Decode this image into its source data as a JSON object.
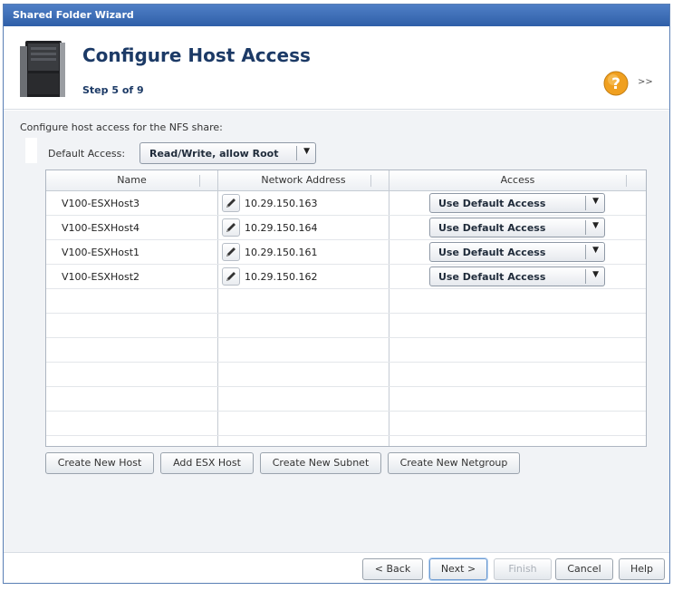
{
  "window": {
    "title": "Shared Folder Wizard"
  },
  "header": {
    "title": "Configure Host Access",
    "step": "Step 5 of 9",
    "expand": ">>"
  },
  "intro": "Configure host access for the NFS share:",
  "default_access": {
    "label": "Default Access:",
    "value": "Read/Write, allow Root"
  },
  "table": {
    "columns": [
      "Name",
      "Network Address",
      "Access"
    ],
    "rows": [
      {
        "name": "V100-ESXHost3",
        "address": "10.29.150.163",
        "access": "Use Default Access"
      },
      {
        "name": "V100-ESXHost4",
        "address": "10.29.150.164",
        "access": "Use Default Access"
      },
      {
        "name": "V100-ESXHost1",
        "address": "10.29.150.161",
        "access": "Use Default Access"
      },
      {
        "name": "V100-ESXHost2",
        "address": "10.29.150.162",
        "access": "Use Default Access"
      }
    ]
  },
  "actions": {
    "create_host": "Create New Host",
    "add_esx": "Add ESX Host",
    "create_subnet": "Create New Subnet",
    "create_netgroup": "Create New Netgroup"
  },
  "footer": {
    "back": "< Back",
    "next": "Next >",
    "finish": "Finish",
    "cancel": "Cancel",
    "help": "Help"
  },
  "colors": {
    "title_bar": "#2f5fa8",
    "heading": "#1c3a66",
    "help_icon": "#f0a020"
  }
}
